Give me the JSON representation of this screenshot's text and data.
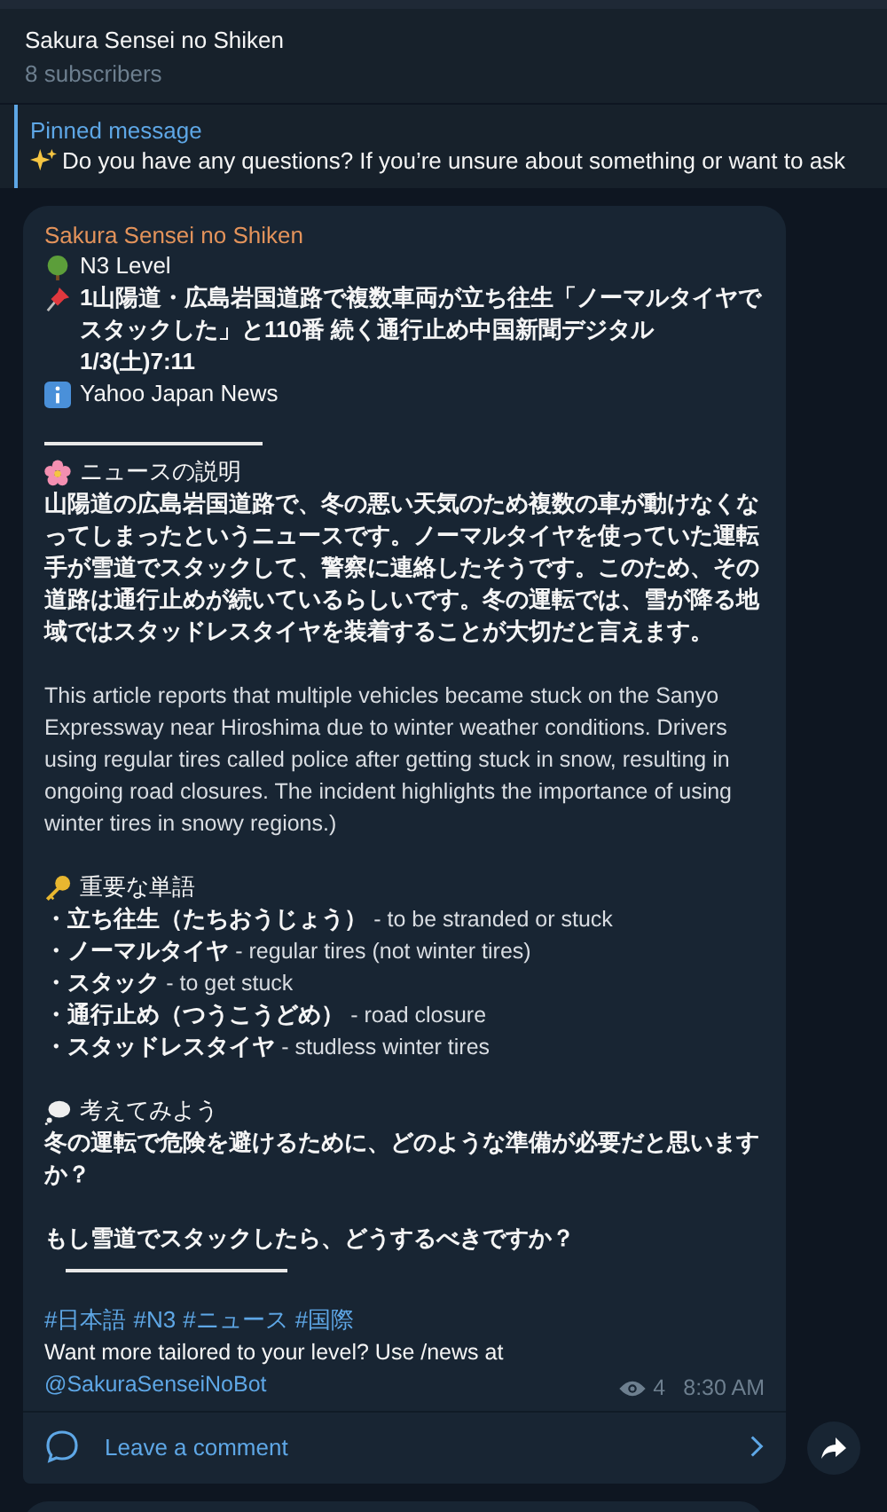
{
  "header": {
    "title": "Sakura Sensei no Shiken",
    "subtitle": "8 subscribers"
  },
  "pinned": {
    "label": "Pinned message",
    "text": "Do you have any questions? If you’re unsure about something or want to ask"
  },
  "post": {
    "author": "Sakura Sensei no Shiken",
    "level": "N3 Level",
    "headline": "1山陽道・広島岩国道路で複数車両が立ち往生「ノーマルタイヤでスタックした」と110番 続く通行止め中国新聞デジタル1/3(土)7:11",
    "source": "Yahoo Japan News",
    "explanation_heading": "ニュースの説明",
    "explanation": "山陽道の広島岩国道路で、冬の悪い天気のため複数の車が動けなくなってしまったというニュースです。ノーマルタイヤを使っていた運転手が雪道でスタックして、警察に連絡したそうです。このため、その道路は通行止めが続いているらしいです。冬の運転では、雪が降る地域ではスタッドレスタイヤを装着することが大切だと言えます。",
    "translation": "This article reports that multiple vehicles became stuck on the Sanyo Expressway near Hiroshima due to winter weather conditions. Drivers using regular tires called police after getting stuck in snow, resulting in ongoing road closures. The incident highlights the importance of using winter tires in snowy regions.)",
    "vocabulary_heading": "重要な単語",
    "vocabulary": [
      {
        "term": "・立ち往生（たちおうじょう）",
        "meaning": "- to be stranded or stuck"
      },
      {
        "term": "・ノーマルタイヤ",
        "meaning": "- regular tires (not winter tires)"
      },
      {
        "term": "・スタック",
        "meaning": "- to get stuck"
      },
      {
        "term": "・通行止め（つうこうどめ）",
        "meaning": "- road closure"
      },
      {
        "term": "・スタッドレスタイヤ",
        "meaning": "- studless winter tires"
      }
    ],
    "think_heading": "考えてみよう",
    "questions": [
      "冬の運転で危険を避けるために、どのような準備が必要だと思いますか？",
      "もし雪道でスタックしたら、どうするべきですか？"
    ],
    "hashtags": [
      "#日本語",
      "#N3",
      "#ニュース",
      "#国際"
    ],
    "footer_text": "Want more tailored to your level? Use /news at",
    "bot_link": "@SakuraSenseiNoBot",
    "views": "4",
    "time": "8:30 AM",
    "comment_label": "Leave a comment"
  }
}
